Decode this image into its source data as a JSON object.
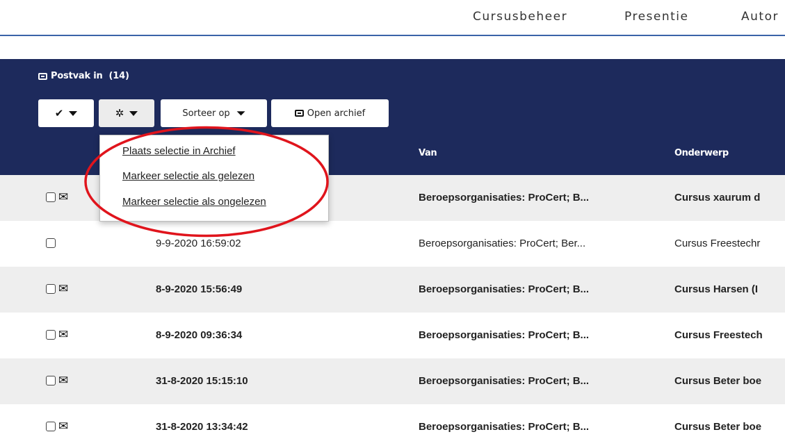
{
  "nav": {
    "items": [
      "Cursusbeheer",
      "Presentie",
      "Autor"
    ]
  },
  "inbox": {
    "title": "Postvak in",
    "count": "(14)",
    "icon": "inbox-tray-icon"
  },
  "toolbar": {
    "select_icon": "checkmark-icon",
    "actions_icon": "gear-icon",
    "sort_label": "Sorteer op",
    "sort_icon": "filter-icon",
    "archive_label": "Open archief",
    "archive_icon": "inbox-tray-icon"
  },
  "table": {
    "headers": {
      "van": "Van",
      "onderwerp": "Onderwerp"
    },
    "rows": [
      {
        "unread": true,
        "date": "",
        "from": "Beroepsorganisaties: ProCert; B...",
        "subject": "Cursus xaurum d"
      },
      {
        "unread": false,
        "date": "9-9-2020 16:59:02",
        "from": "Beroepsorganisaties: ProCert; Ber...",
        "subject": "Cursus Freestechr"
      },
      {
        "unread": true,
        "date": "8-9-2020 15:56:49",
        "from": "Beroepsorganisaties: ProCert; B...",
        "subject": "Cursus Harsen (I"
      },
      {
        "unread": true,
        "date": "8-9-2020 09:36:34",
        "from": "Beroepsorganisaties: ProCert; B...",
        "subject": "Cursus Freestech"
      },
      {
        "unread": true,
        "date": "31-8-2020 15:15:10",
        "from": "Beroepsorganisaties: ProCert; B...",
        "subject": "Cursus Beter boe"
      },
      {
        "unread": true,
        "date": "31-8-2020 13:34:42",
        "from": "Beroepsorganisaties: ProCert; B...",
        "subject": "Cursus Beter boe"
      }
    ]
  },
  "dropdown": {
    "items": [
      "Plaats selectie in Archief",
      "Markeer selectie als gelezen",
      "Markeer selectie als ongelezen"
    ]
  },
  "colors": {
    "panel": "#1d2a5c",
    "nav_underline": "#3a63a8",
    "annotation": "#e0141c",
    "row_alt": "#eeeeee"
  }
}
